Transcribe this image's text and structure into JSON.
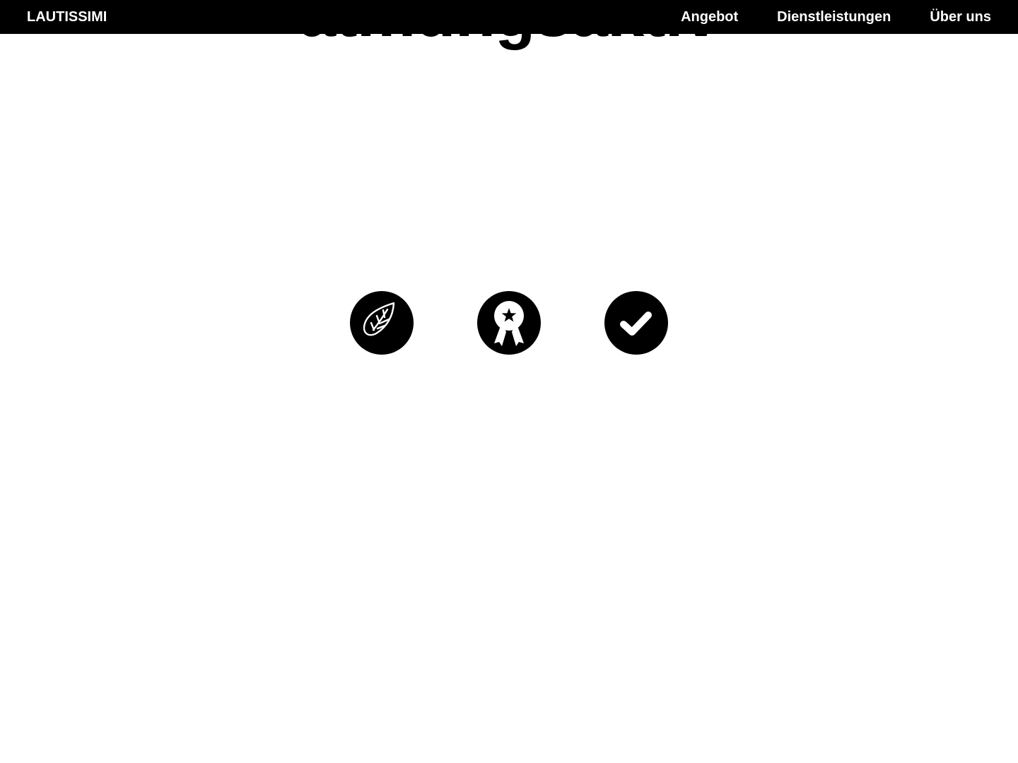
{
  "hero": {
    "heading": "atmungsaktiv"
  },
  "navbar": {
    "brand": "LAUTISSIMI",
    "links": [
      {
        "label": "Angebot"
      },
      {
        "label": "Dienstleistungen"
      },
      {
        "label": "Über uns"
      }
    ]
  },
  "features": [
    {
      "icon": "leaf-icon"
    },
    {
      "icon": "award-ribbon-icon"
    },
    {
      "icon": "checkmark-icon"
    }
  ],
  "colors": {
    "background": "#ffffff",
    "navbar": "#000000",
    "text": "#000000",
    "nav_text": "#ffffff"
  }
}
